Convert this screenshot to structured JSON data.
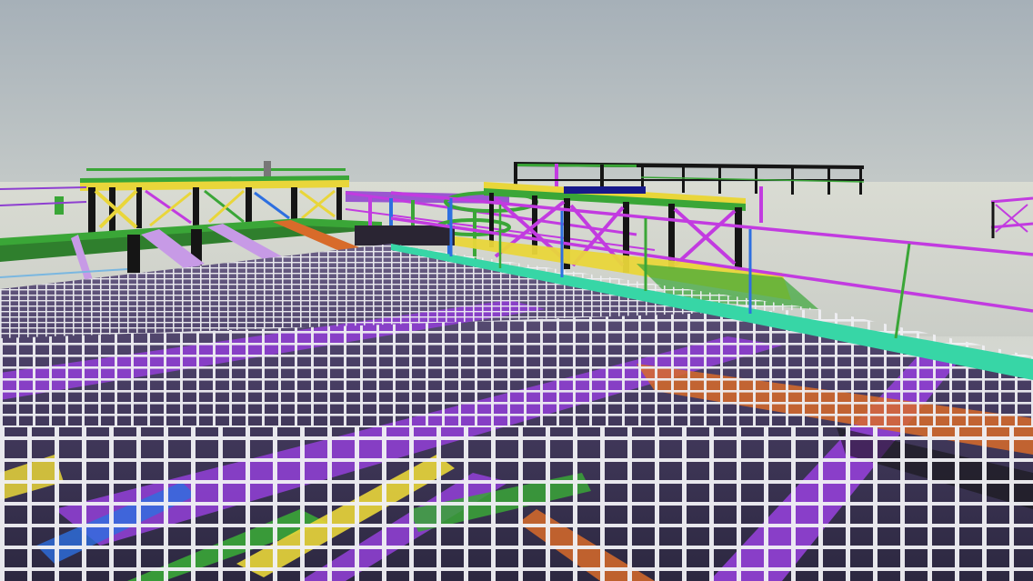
{
  "scene": {
    "description_label": "",
    "palette": {
      "sky_top": "#9fabb5",
      "sky_horizon": "#dde0d4",
      "haze": "#d3d6cf",
      "grating_bars": "#e8e8ee",
      "grating_shadow": "#3a3550",
      "purple_beam": "#8e3fd0",
      "magenta_rail": "#c23be0",
      "teal_edge": "#37d6a6",
      "green_beam": "#3aa637",
      "yellow_beam": "#e9d63a",
      "black_column": "#151515",
      "orange_beam": "#d86b2a",
      "blue_post": "#2d6fe0",
      "lilac_stair": "#c79ae6"
    }
  }
}
